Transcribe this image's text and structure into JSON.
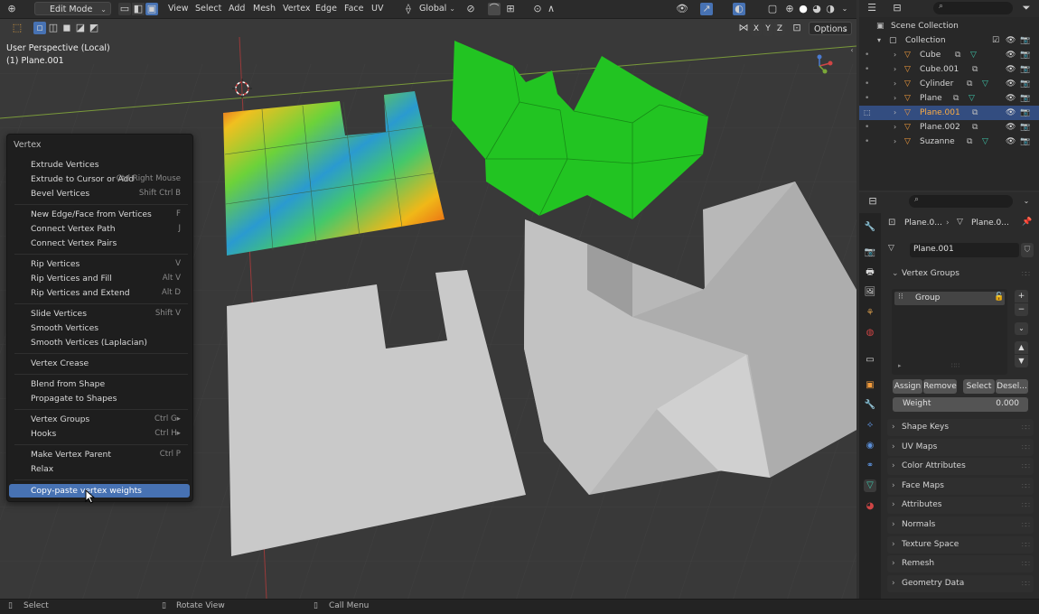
{
  "header": {
    "mode": "Edit Mode",
    "menus": [
      "View",
      "Select",
      "Add",
      "Mesh",
      "Vertex",
      "Edge",
      "Face",
      "UV"
    ],
    "transform_orientation": "Global",
    "options_label": "Options",
    "axis_x": "X",
    "axis_y": "Y",
    "axis_z": "Z"
  },
  "viewport": {
    "perspective": "User Perspective (Local)",
    "object": "(1) Plane.001"
  },
  "vertex_menu": {
    "title": "Vertex",
    "items": [
      {
        "label": "Extrude Vertices",
        "shortcut": ""
      },
      {
        "label": "Extrude to Cursor or Add",
        "shortcut": "Ctrl Right Mouse"
      },
      {
        "label": "Bevel Vertices",
        "shortcut": "Shift Ctrl B"
      },
      {
        "label": "New Edge/Face from Vertices",
        "shortcut": "F"
      },
      {
        "label": "Connect Vertex Path",
        "shortcut": "J"
      },
      {
        "label": "Connect Vertex Pairs",
        "shortcut": ""
      },
      {
        "label": "Rip Vertices",
        "shortcut": "V"
      },
      {
        "label": "Rip Vertices and Fill",
        "shortcut": "Alt V"
      },
      {
        "label": "Rip Vertices and Extend",
        "shortcut": "Alt D"
      },
      {
        "label": "Slide Vertices",
        "shortcut": "Shift V"
      },
      {
        "label": "Smooth Vertices",
        "shortcut": ""
      },
      {
        "label": "Smooth Vertices (Laplacian)",
        "shortcut": ""
      },
      {
        "label": "Vertex Crease",
        "shortcut": ""
      },
      {
        "label": "Blend from Shape",
        "shortcut": ""
      },
      {
        "label": "Propagate to Shapes",
        "shortcut": ""
      },
      {
        "label": "Vertex Groups",
        "shortcut": "Ctrl G▸"
      },
      {
        "label": "Hooks",
        "shortcut": "Ctrl H▸"
      },
      {
        "label": "Make Vertex Parent",
        "shortcut": "Ctrl P"
      },
      {
        "label": "Relax",
        "shortcut": ""
      },
      {
        "label": "Copy-paste vertex weights",
        "shortcut": ""
      }
    ]
  },
  "outliner": {
    "scene_collection": "Scene Collection",
    "collection": "Collection",
    "objects": [
      "Cube",
      "Cube.001",
      "Cylinder",
      "Plane",
      "Plane.001",
      "Plane.002",
      "Suzanne"
    ]
  },
  "properties": {
    "breadcrumb_object": "Plane.0...",
    "breadcrumb_data": "Plane.0...",
    "mesh_name": "Plane.001",
    "vertex_groups_title": "Vertex Groups",
    "group_item": "Group",
    "assign": "Assign",
    "remove": "Remove",
    "select": "Select",
    "deselect": "Desel...",
    "weight_label": "Weight",
    "weight_value": "0.000",
    "sections": [
      "Shape Keys",
      "UV Maps",
      "Color Attributes",
      "Face Maps",
      "Attributes",
      "Normals",
      "Texture Space",
      "Remesh",
      "Geometry Data"
    ]
  },
  "statusbar": {
    "select": "Select",
    "rotate": "Rotate View",
    "call_menu": "Call Menu"
  },
  "colors": {
    "accent": "#4772b3",
    "selected_object": "#ffae42",
    "green_mesh": "#22c422",
    "gray_mesh": "#c8c8c8"
  }
}
